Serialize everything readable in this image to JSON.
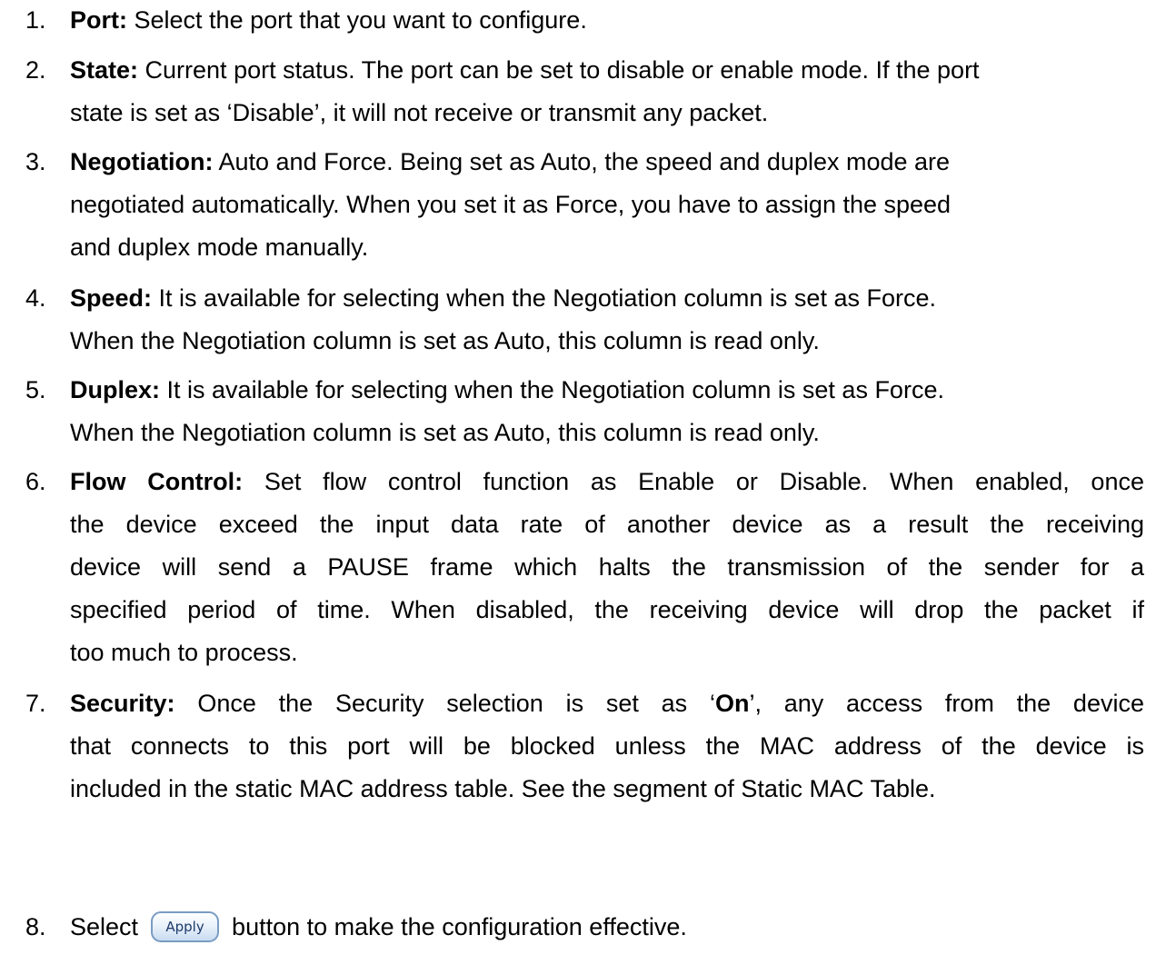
{
  "items": [
    {
      "number": "1.",
      "term": "Port:",
      "lines": [
        "Select the port that you want to configure."
      ]
    },
    {
      "number": "2.",
      "term": "State:",
      "lines": [
        "Current port status. The port can be set to disable or enable mode. If the port",
        "state is set as ‘Disable’, it will not receive or transmit any packet."
      ]
    },
    {
      "number": "3.",
      "term": "Negotiation:",
      "lines": [
        "Auto and Force. Being set as Auto, the speed and duplex mode are",
        "negotiated automatically. When you set it as Force, you have to assign the speed",
        "and duplex mode manually."
      ]
    },
    {
      "number": "4.",
      "term": "Speed:",
      "lines": [
        "It is available for selecting when the Negotiation column is set as Force.",
        "When the Negotiation column is set as Auto, this column is read only."
      ]
    },
    {
      "number": "5.",
      "term": "Duplex:",
      "lines": [
        "It is available for selecting when the Negotiation column is set as Force.",
        "When the Negotiation column is set as Auto, this column is read only."
      ]
    },
    {
      "number": "6.",
      "term": "Flow Control:",
      "lines": [
        "Set flow control function as Enable or Disable. When enabled, once",
        "the device exceed the input data rate of another device as a result the receiving",
        "device will send a PAUSE frame which halts the transmission of the sender for a",
        "specified period of time. When disabled, the receiving device will drop the packet if",
        "too much to process."
      ]
    },
    {
      "number": "7.",
      "term": "Security:",
      "line1_before": "Once the Security selection is set as ‘",
      "line1_bold": "On",
      "line1_after": "’, any access from the device",
      "lines": [
        "that connects to this port will be blocked unless the MAC address of the device is",
        "included in the static MAC address table. See the segment of Static MAC Table."
      ]
    },
    {
      "number": "8.",
      "before": "Select",
      "button_label": "Apply",
      "after": "button to make the configuration effective."
    }
  ]
}
